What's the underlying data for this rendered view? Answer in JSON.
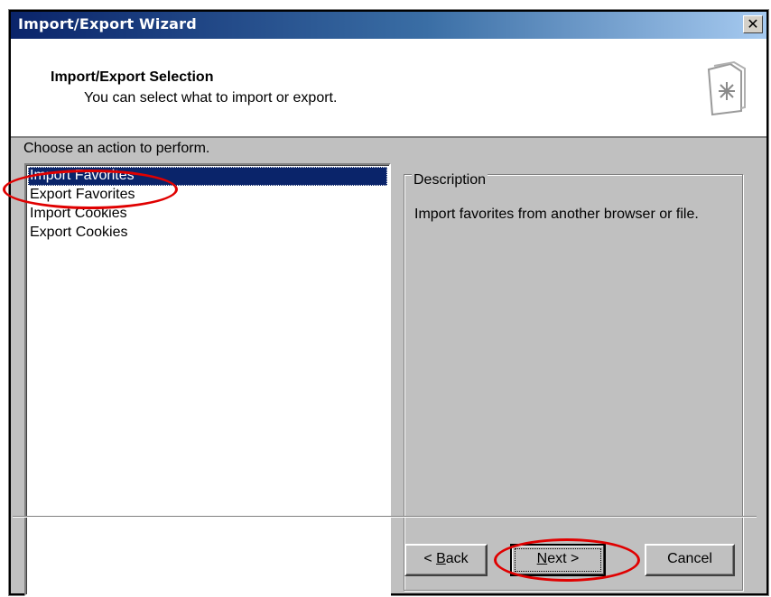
{
  "window": {
    "title": "Import/Export Wizard",
    "close_icon": "close-icon",
    "close_glyph": "✕"
  },
  "header": {
    "title": "Import/Export Selection",
    "subtitle": "You can select what to import or export.",
    "icon": "wizard-document-icon"
  },
  "main": {
    "choose_label": "Choose an action to perform.",
    "actions": [
      {
        "label": "Import Favorites",
        "selected": true
      },
      {
        "label": "Export Favorites",
        "selected": false
      },
      {
        "label": "Import Cookies",
        "selected": false
      },
      {
        "label": "Export Cookies",
        "selected": false
      }
    ],
    "description": {
      "label": "Description",
      "text": "Import favorites from another browser or file."
    }
  },
  "buttons": {
    "back_prefix": "< ",
    "back_key": "B",
    "back_rest": "ack",
    "next_key": "N",
    "next_rest": "ext >",
    "cancel": "Cancel"
  },
  "colors": {
    "selection": "#0a246a",
    "annotation": "#e00000",
    "face": "#c0c0c0"
  }
}
